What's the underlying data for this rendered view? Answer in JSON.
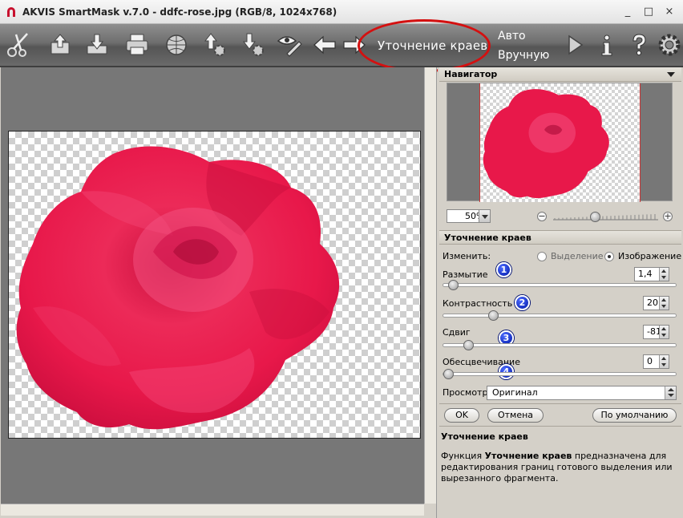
{
  "window": {
    "title": "AKVIS SmartMask v.7.0 - ddfc-rose.jpg (RGB/8, 1024x768)",
    "minimize": "_",
    "maximize": "□",
    "close": "×"
  },
  "toolbar": {
    "icons": [
      "scissors-logo-icon",
      "export-icon",
      "save-icon",
      "print-icon",
      "web-icon",
      "upload-settings-icon",
      "download-settings-icon",
      "eye-pencil-icon",
      "undo-arrow-icon",
      "redo-arrow-icon",
      "run-icon",
      "info-icon",
      "help-icon",
      "settings-icon"
    ],
    "mode_refine": "Уточнение краев",
    "mode_auto": "Авто",
    "mode_manual": "Вручную",
    "highlight_color": "#d41010"
  },
  "navigator": {
    "title": "Навигатор",
    "zoom_value": "50%",
    "zoom_minus": "−",
    "zoom_plus": "+",
    "zoom_level": 0.4
  },
  "refine": {
    "title": "Уточнение краев",
    "change_label": "Изменить:",
    "radio_selection": "Выделение",
    "radio_image": "Изображение",
    "selected_radio": "Изображение",
    "params": [
      {
        "label": "Размытие",
        "value": "1,4",
        "badge": "1",
        "level": 0.02
      },
      {
        "label": "Контрастность",
        "value": "20",
        "badge": "2",
        "level": 0.2
      },
      {
        "label": "Сдвиг",
        "value": "-81",
        "badge": "3",
        "level": 0.09
      },
      {
        "label": "Обесцвечивание",
        "value": "0",
        "badge": "4",
        "level": 0.0
      }
    ],
    "preview_label": "Просмотр:",
    "preview_value": "Оригинал",
    "ok": "OK",
    "cancel": "Отмена",
    "default": "По умолчанию"
  },
  "help": {
    "title": "Уточнение краев",
    "text_prefix": "Функция ",
    "text_bold": "Уточнение краев",
    "text_rest": " предназначена для редактирования границ готового выделения или вырезанного фрагмента."
  },
  "colors": {
    "rose": "#e8184a",
    "badge": "#0018a8"
  }
}
